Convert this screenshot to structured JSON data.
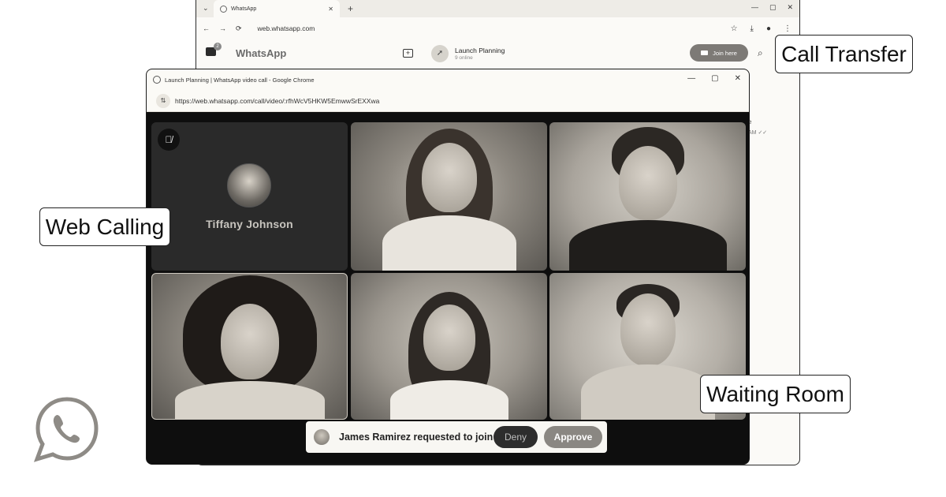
{
  "back_browser": {
    "tab_title": "WhatsApp",
    "tab_close": "✕",
    "tab_chevron": "⌄",
    "new_tab": "+",
    "window_controls": [
      "—",
      "▢",
      "✕"
    ],
    "nav": {
      "back": "←",
      "forward": "→",
      "reload": "⟳"
    },
    "url": "web.whatsapp.com",
    "toolbar_icons": [
      "☆",
      "⤓",
      "●",
      "⋮"
    ]
  },
  "whatsapp": {
    "title": "WhatsApp",
    "chats_badge": "2",
    "chat_name": "Launch Planning",
    "chat_subtitle": "9 online",
    "group_avatar_icon": "rocket-icon",
    "join_button": "Join here",
    "search_icon": "⌕",
    "message_fragment_1": "e",
    "message_fragment_2": "AM ✓✓"
  },
  "call_window": {
    "title": "Launch Planning | WhatsApp video call - Google Chrome",
    "window_controls": [
      "—",
      "▢",
      "✕"
    ],
    "url": "https://web.whatsapp.com/call/video/:rfhWcV5HKW5EmwwSrEXXwa",
    "tune_icon": "⇅"
  },
  "participants": [
    {
      "name": "Tiffany Johnson",
      "muted": true,
      "camera_off": true
    },
    {
      "name": ""
    },
    {
      "name": ""
    },
    {
      "name": ""
    },
    {
      "name": ""
    },
    {
      "name": ""
    }
  ],
  "join_request": {
    "text": "James Ramirez requested to join",
    "deny": "Deny",
    "approve": "Approve"
  },
  "controls": {
    "camera": "■",
    "camera_caret": "▾",
    "mic": "🎙",
    "mic_caret": "▾",
    "emoji": "☺",
    "raise_hand": "✋",
    "share_screen": "▭",
    "participants": "👥",
    "calendar": "▦",
    "end_call": "☎"
  },
  "labels": {
    "web_calling": "Web Calling",
    "call_transfer": "Call Transfer",
    "waiting_room": "Waiting Room"
  },
  "colors": {
    "call_background": "#0e0e0e",
    "approve": "#8a8782",
    "deny": "#2d2d2d",
    "join_button": "#7d7a76"
  }
}
